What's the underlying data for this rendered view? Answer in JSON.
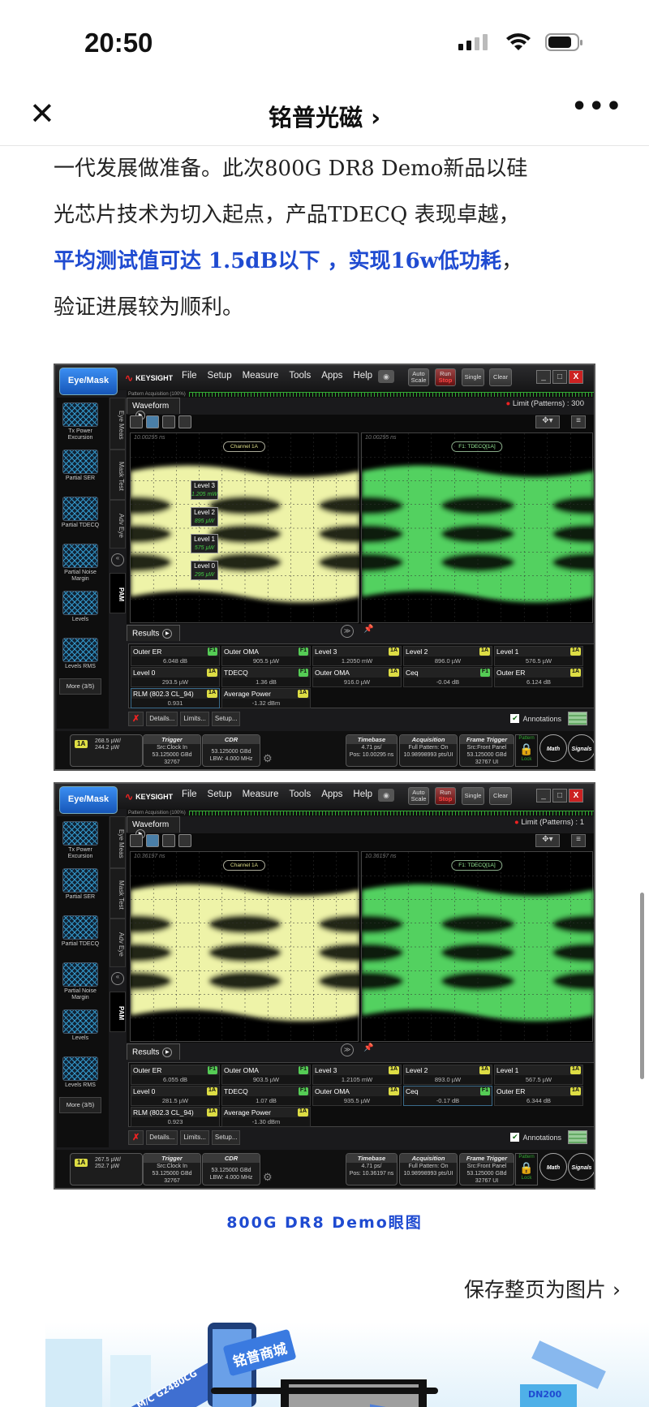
{
  "status_bar": {
    "time": "20:50"
  },
  "nav": {
    "close_icon": "close-icon",
    "title": "铭普光磁 ›",
    "more_icon": "more-horizontal-icon"
  },
  "article": {
    "line1": "一代发展做准备。此次800G DR8 Demo新品以硅",
    "line2": "光芯片技术为切入起点，产品TDECQ 表现卓越，",
    "line3_highlight": "平均测试值可达 1.5dB以下 ，实现16w低功耗",
    "line3_tail": "，",
    "line4": "验证进展较为顺利。",
    "highlight_color": "#1f4bd1",
    "caption": "800G DR8 Demo眼图"
  },
  "save_page": "保存整页为图片 ›",
  "banner": {
    "labels": [
      "铭普商城",
      "M/C G2480CG",
      "DN200"
    ]
  },
  "scope_common": {
    "eye_mask": "Eye/Mask",
    "brand": "KEYSIGHT",
    "menu": [
      "File",
      "Setup",
      "Measure",
      "Tools",
      "Apps",
      "Help"
    ],
    "auto_scale": "Auto Scale",
    "run": "Run",
    "stop": "Stop",
    "single": "Single",
    "clear": "Clear",
    "pattern_acq": "Pattern Acquisition (100%)",
    "waveform_tab": "Waveform",
    "results_tab": "Results",
    "sidebar": [
      "Tx Power Excursion",
      "Partial SER",
      "Partial TDECQ",
      "Partial Noise Margin",
      "Levels",
      "Levels RMS"
    ],
    "more": "More (3/5)",
    "vtabs": [
      "Eye Meas",
      "Mask Test",
      "Adv Eye",
      "PAM"
    ],
    "details": "Details...",
    "limits": "Limits...",
    "setup": "Setup...",
    "annotations": "Annotations",
    "trigger": {
      "title": "Trigger",
      "l1": "Src:Clock In",
      "l2": "53.125000 GBd",
      "l3": "32767"
    },
    "cdr": {
      "title": "CDR",
      "l1": "53.125000 GBd",
      "l2": "LBW: 4.000 MHz"
    },
    "acquisition": {
      "title": "Acquisition",
      "l1": "Full Pattern: On",
      "l2": "10.98998993 pts/UI"
    },
    "frame_trigger": {
      "title": "Frame Trigger",
      "l1": "Src:Front Panel",
      "l2": "53.125000 GBd",
      "l3": "32767 UI"
    },
    "pattern_lock": {
      "top": "Pattern",
      "bottom": "Lock"
    },
    "math": "Math",
    "signals": "Signals",
    "channel_label": "Channel 1A",
    "func_label": "F1: TDECQ[1A]",
    "channel_badge": "1A",
    "eye_colors": {
      "channel": "#eef3a8",
      "func": "#52d160"
    }
  },
  "scopes": [
    {
      "limit": "Limit (Patterns) : 300",
      "timestamp": "10.00295 ns",
      "timebase": {
        "title": "Timebase",
        "l1": "4.71 ps/",
        "l2": "Pos: 10.00295 ns"
      },
      "channel_power": {
        "l1": "268.5 µW/",
        "l2": "244.2 µW"
      },
      "levels": [
        {
          "name": "Level 3",
          "value": "1.205 mW"
        },
        {
          "name": "Level 2",
          "value": "895 µW"
        },
        {
          "name": "Level 1",
          "value": "575 µW"
        },
        {
          "name": "Level 0",
          "value": "295 µW"
        }
      ],
      "selected": "RLM (802.3 CL_94)",
      "results": [
        {
          "name": "Outer ER",
          "src": "F1",
          "value": "6.048 dB"
        },
        {
          "name": "Outer OMA",
          "src": "F1",
          "value": "905.5 µW"
        },
        {
          "name": "Level 3",
          "src": "1A",
          "value": "1.2050 mW"
        },
        {
          "name": "Level 2",
          "src": "1A",
          "value": "896.0 µW"
        },
        {
          "name": "Level 1",
          "src": "1A",
          "value": "576.5 µW"
        },
        {
          "name": "Level 0",
          "src": "1A",
          "value": "293.5 µW"
        },
        {
          "name": "TDECQ",
          "src": "F1",
          "value": "1.36 dB"
        },
        {
          "name": "Outer OMA",
          "src": "1A",
          "value": "916.0 µW"
        },
        {
          "name": "Ceq",
          "src": "F1",
          "value": "-0.04 dB"
        },
        {
          "name": "Outer ER",
          "src": "1A",
          "value": "6.124 dB"
        },
        {
          "name": "RLM (802.3 CL_94)",
          "src": "1A",
          "value": "0.931"
        },
        {
          "name": "Average Power",
          "src": "1A",
          "value": "-1.32 dBm"
        }
      ]
    },
    {
      "limit": "Limit (Patterns) : 1",
      "timestamp": "10.36197 ns",
      "timebase": {
        "title": "Timebase",
        "l1": "4.71 ps/",
        "l2": "Pos: 10.36197 ns"
      },
      "channel_power": {
        "l1": "267.5 µW/",
        "l2": "252.7 µW"
      },
      "levels": [],
      "selected": "Ceq",
      "results": [
        {
          "name": "Outer ER",
          "src": "F1",
          "value": "6.055 dB"
        },
        {
          "name": "Outer OMA",
          "src": "F1",
          "value": "903.5 µW"
        },
        {
          "name": "Level 3",
          "src": "1A",
          "value": "1.2105 mW"
        },
        {
          "name": "Level 2",
          "src": "1A",
          "value": "893.0 µW"
        },
        {
          "name": "Level 1",
          "src": "1A",
          "value": "567.5 µW"
        },
        {
          "name": "Level 0",
          "src": "1A",
          "value": "281.5 µW"
        },
        {
          "name": "TDECQ",
          "src": "F1",
          "value": "1.07 dB"
        },
        {
          "name": "Outer OMA",
          "src": "1A",
          "value": "935.5 µW"
        },
        {
          "name": "Ceq",
          "src": "F1",
          "value": "-0.17 dB"
        },
        {
          "name": "Outer ER",
          "src": "1A",
          "value": "6.344 dB"
        },
        {
          "name": "RLM (802.3 CL_94)",
          "src": "1A",
          "value": "0.923"
        },
        {
          "name": "Average Power",
          "src": "1A",
          "value": "-1.30 dBm"
        }
      ]
    }
  ]
}
